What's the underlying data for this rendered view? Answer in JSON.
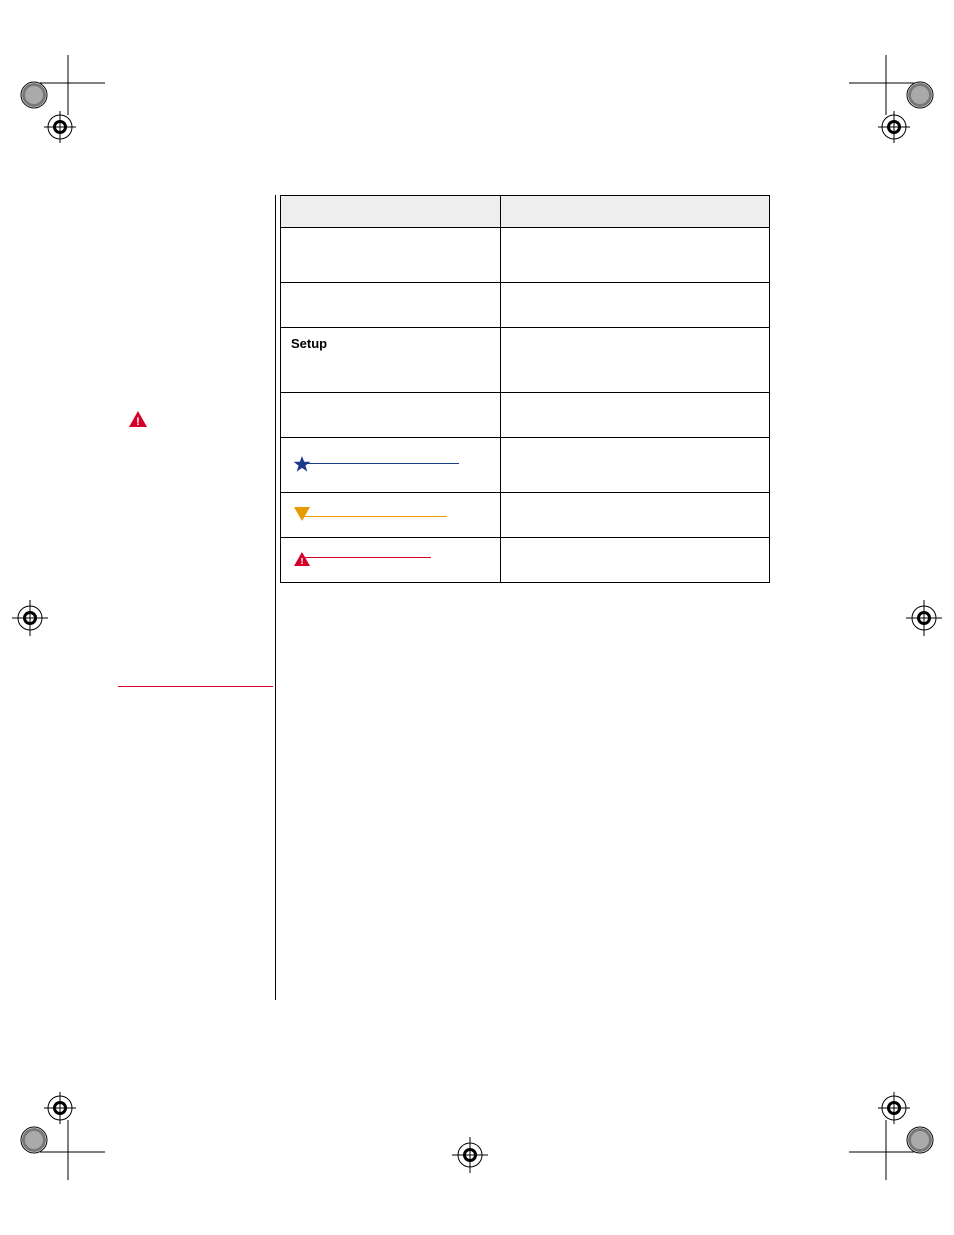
{
  "table": {
    "col1_header": "",
    "col2_header": "",
    "rows": [
      {
        "col1": "",
        "col2": ""
      },
      {
        "col1": "",
        "col2": ""
      },
      {
        "col1_label": "Setup",
        "col2": ""
      },
      {
        "col1": "",
        "col2": ""
      },
      {
        "col1_icon": "star",
        "col2": ""
      },
      {
        "col1_icon": "triangle",
        "col2": ""
      },
      {
        "col1_icon": "warning",
        "col2": ""
      }
    ]
  },
  "icons": {
    "star_color": "#1a3a8a",
    "triangle_color": "#e69a00",
    "warning_color": "#d4002a"
  }
}
